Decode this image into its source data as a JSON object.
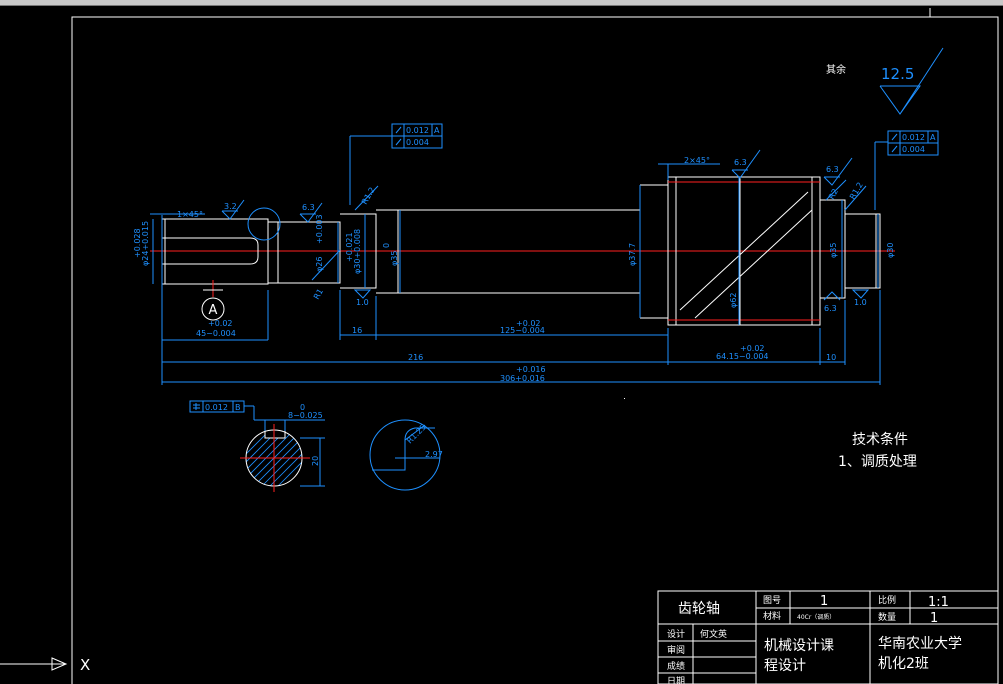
{
  "tech": {
    "title": "技术条件",
    "item1": "1、调质处理"
  },
  "roughness": {
    "rest_label": "其余",
    "rest_value": "12.5",
    "ra_32": "3.2",
    "ra_63": "6.3",
    "ra_10": "1.0"
  },
  "gdt": {
    "runout_left_val1": "0.012",
    "runout_left_val2": "0.004",
    "runout_right_val1": "0.012",
    "runout_right_val2": "0.004",
    "datum": "A",
    "key_sym": "0.012",
    "key_datum": "B"
  },
  "dims": {
    "chamfer_left": "1×45°",
    "chamfer_right": "2×45°",
    "d_end": "φ24+0.015",
    "d_end_tol": "+0.028",
    "d_seal": "φ26",
    "d_seal_tol": "+0.003",
    "d_bear": "φ30+0.008",
    "d_bear_tol": "+0.021",
    "d_shaft": "φ35",
    "d_shaft_tol": "0",
    "d_shoulder": "φ37.7",
    "d_gear": "φ62",
    "d_neck": "φ35",
    "d_right": "φ30",
    "r1": "R1",
    "r12": "R1.2",
    "r2": "R2",
    "l45": "45−0.004",
    "l45_tol": "+0.02",
    "l16": "16",
    "l125": "125−0.004",
    "l125_tol": "+0.02",
    "l216": "216",
    "l64": "64.15−0.004",
    "l64_tol": "+0.02",
    "l10": "10",
    "l306": "306+0.016",
    "l306_tol": "+0.016",
    "key_w": "8−0.025",
    "key_w_tol": "0",
    "key_h": "20",
    "detail_r": "R1.25",
    "detail_d": "2.97",
    "datum_a": "A"
  },
  "title_block": {
    "part_name": "齿轮轴",
    "drawing_no_label": "图号",
    "drawing_no": "1",
    "material_label": "材料",
    "material": "40Cr（调质）",
    "scale_label": "比例",
    "scale": "1:1",
    "qty_label": "数量",
    "qty": "1",
    "design_label": "设计",
    "designer": "何文英",
    "review_label": "审阅",
    "grade_label": "成绩",
    "date_label": "日期",
    "course_line1": "机械设计课",
    "course_line2": "程设计",
    "school_line1": "华南农业大学",
    "school_line2": "机化2班"
  },
  "ucs": {
    "x_label": "X"
  }
}
